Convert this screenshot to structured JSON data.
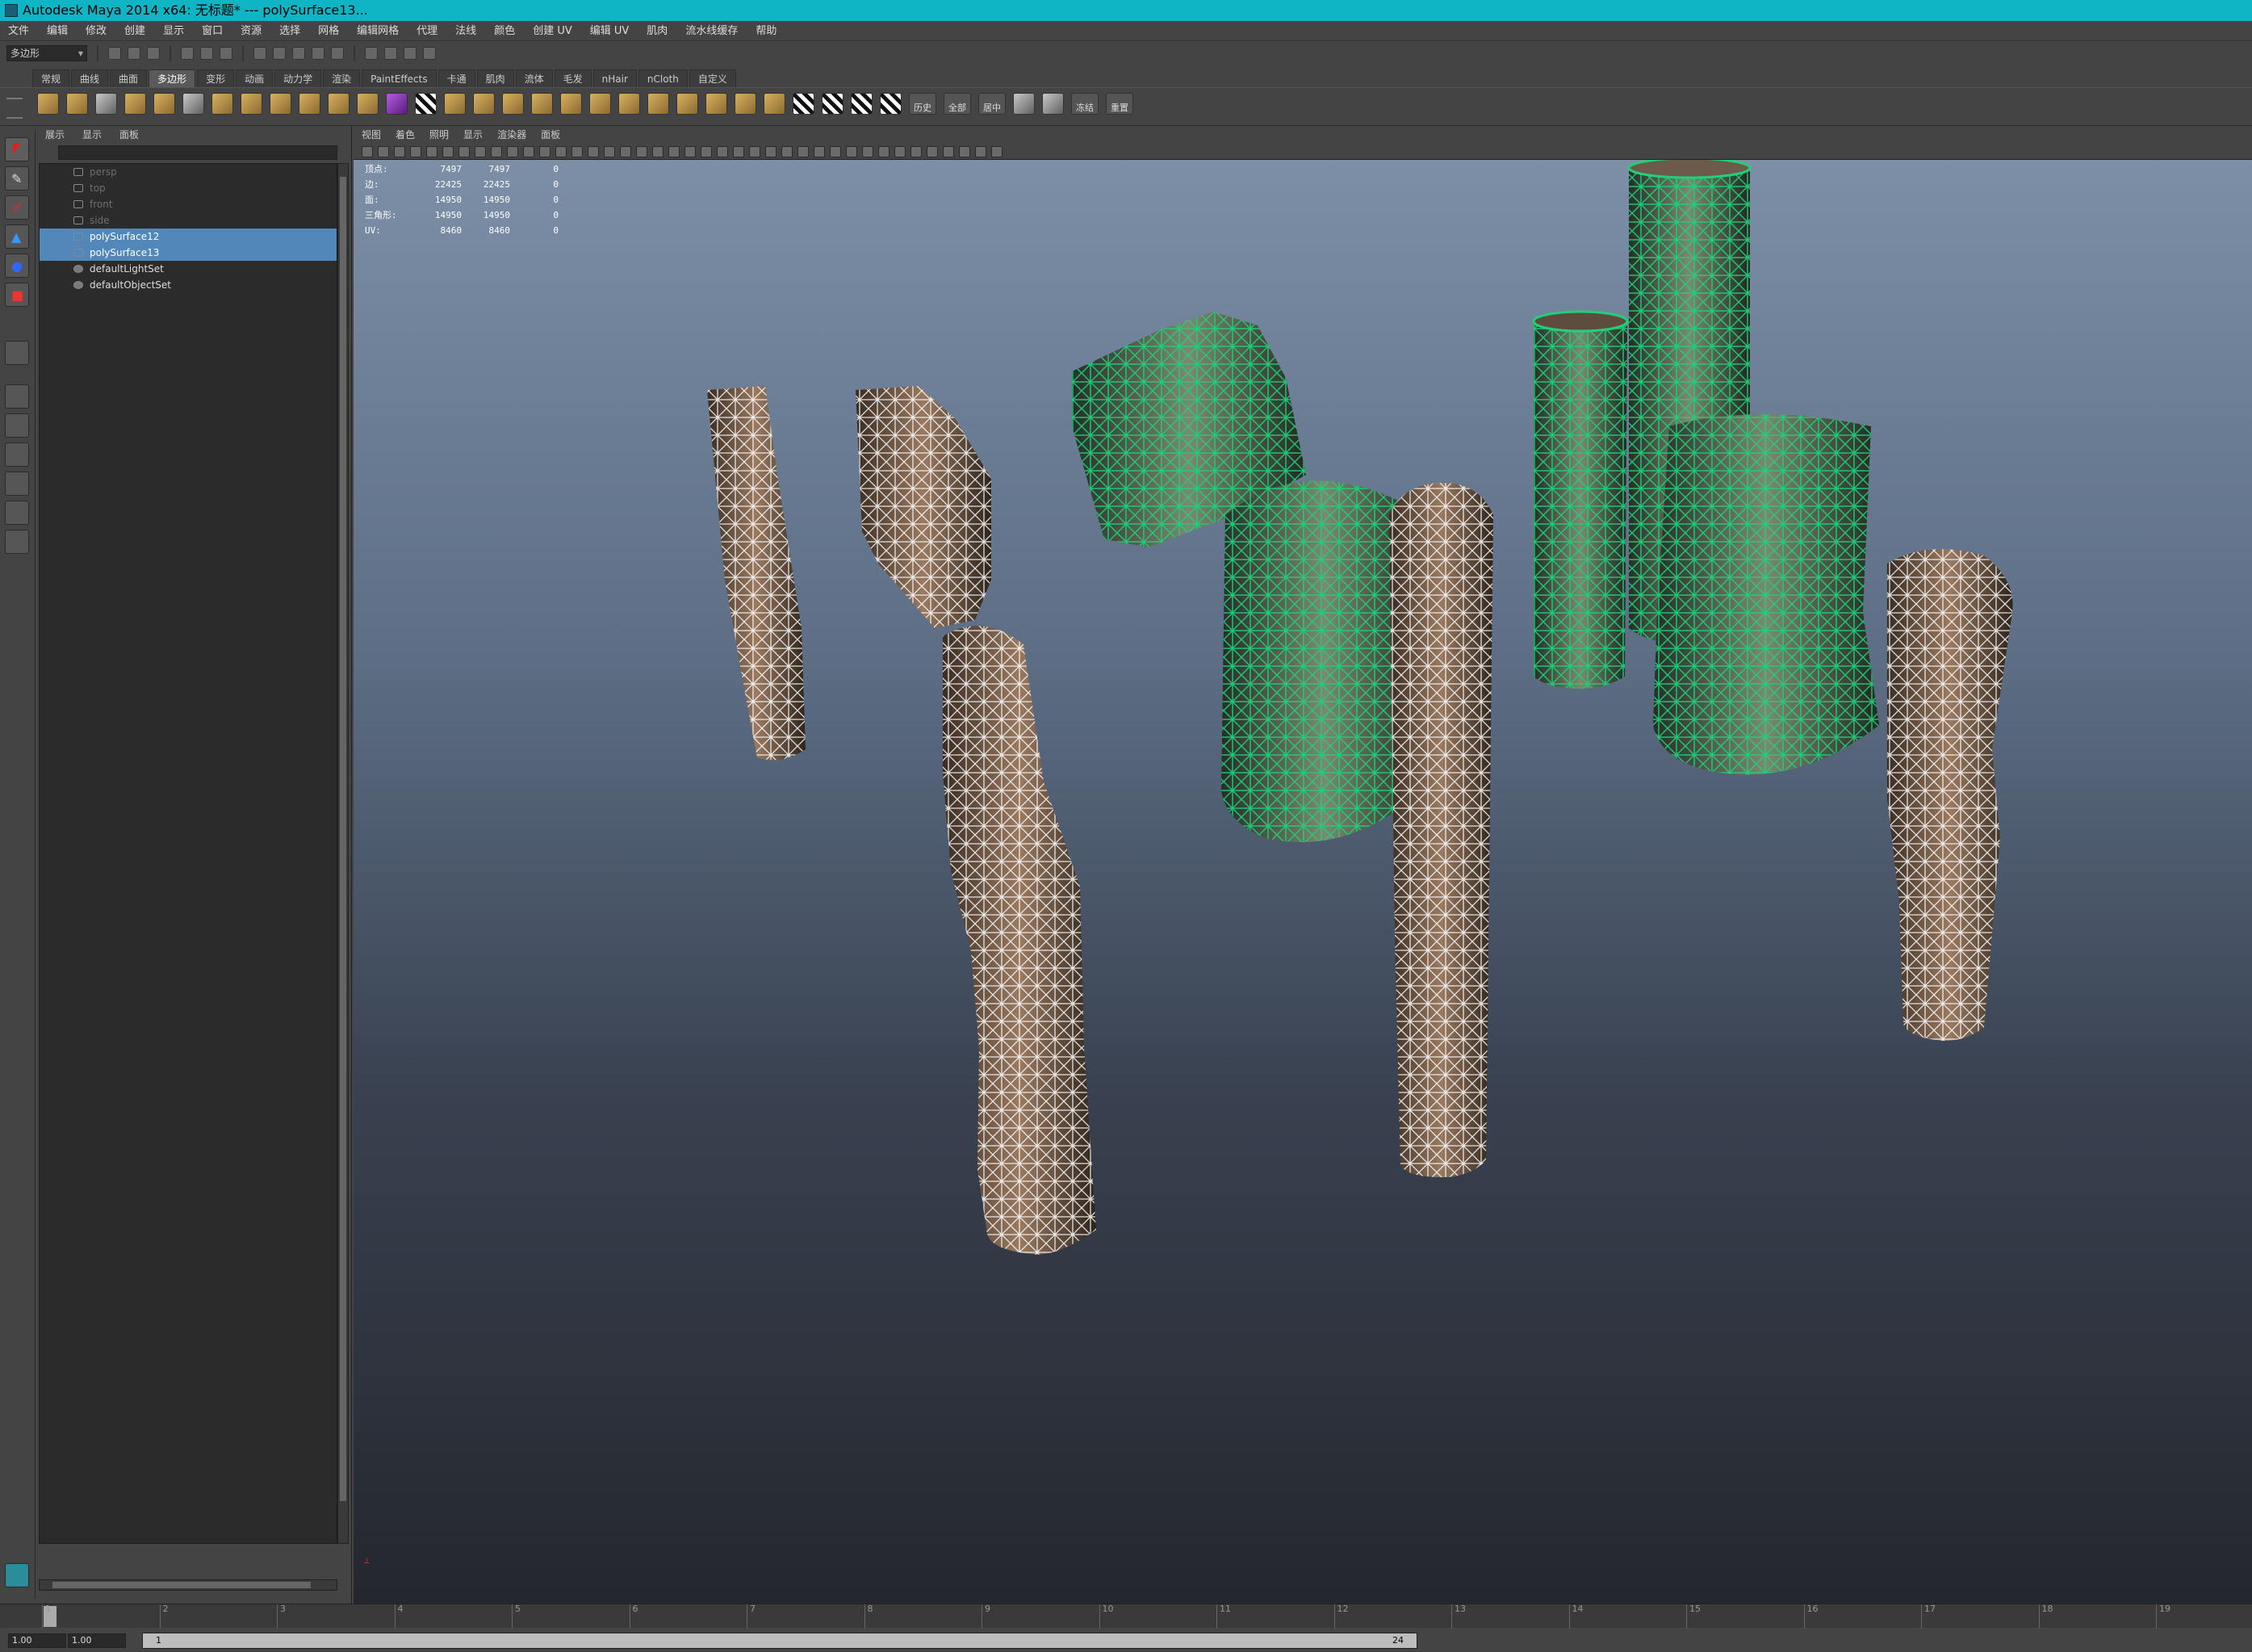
{
  "window": {
    "title": "Autodesk Maya 2014 x64: 无标题*   ---   polySurface13..."
  },
  "menubar": [
    "文件",
    "编辑",
    "修改",
    "创建",
    "显示",
    "窗口",
    "资源",
    "选择",
    "网格",
    "编辑网格",
    "代理",
    "法线",
    "颜色",
    "创建 UV",
    "编辑 UV",
    "肌肉",
    "流水线缓存",
    "帮助"
  ],
  "statusline": {
    "mode": "多边形"
  },
  "shelf": {
    "tabs": [
      "常规",
      "曲线",
      "曲面",
      "多边形",
      "变形",
      "动画",
      "动力学",
      "渲染",
      "PaintEffects",
      "卡通",
      "肌肉",
      "流体",
      "毛发",
      "nHair",
      "nCloth",
      "自定义"
    ],
    "active_tab": "多边形",
    "labels": {
      "history": "历史",
      "all": "全部",
      "center": "居中",
      "freeze": "冻结",
      "reset": "重置"
    }
  },
  "outliner": {
    "menu": [
      "展示",
      "显示",
      "面板"
    ],
    "items": [
      {
        "label": "persp",
        "state": "dim"
      },
      {
        "label": "top",
        "state": "dim"
      },
      {
        "label": "front",
        "state": "dim"
      },
      {
        "label": "side",
        "state": "dim"
      },
      {
        "label": "polySurface12",
        "state": "selected"
      },
      {
        "label": "polySurface13",
        "state": "selected"
      },
      {
        "label": "defaultLightSet",
        "state": "set"
      },
      {
        "label": "defaultObjectSet",
        "state": "set"
      }
    ]
  },
  "viewport": {
    "menu": [
      "视图",
      "着色",
      "照明",
      "显示",
      "渲染器",
      "面板"
    ],
    "hud": [
      {
        "label": "顶点:",
        "v1": "7497",
        "v2": "7497",
        "v3": "0"
      },
      {
        "label": "边:",
        "v1": "22425",
        "v2": "22425",
        "v3": "0"
      },
      {
        "label": "面:",
        "v1": "14950",
        "v2": "14950",
        "v3": "0"
      },
      {
        "label": "三角形:",
        "v1": "14950",
        "v2": "14950",
        "v3": "0"
      },
      {
        "label": "UV:",
        "v1": "8460",
        "v2": "8460",
        "v3": "0"
      }
    ],
    "colors": {
      "wire_selected": "#22d07a",
      "wire_unselected": "#ffffff",
      "wood": "#7a5f4a",
      "wood_green": "#4e6a4c"
    }
  },
  "timeline": {
    "ticks": [
      "1",
      "2",
      "3",
      "4",
      "5",
      "6",
      "7",
      "8",
      "9",
      "10",
      "11",
      "12",
      "13",
      "14",
      "15",
      "16",
      "17",
      "18",
      "19"
    ],
    "current": "1"
  },
  "range": {
    "start": "1.00",
    "start2": "1.00",
    "bar_start": "1",
    "bar_end": "24"
  }
}
